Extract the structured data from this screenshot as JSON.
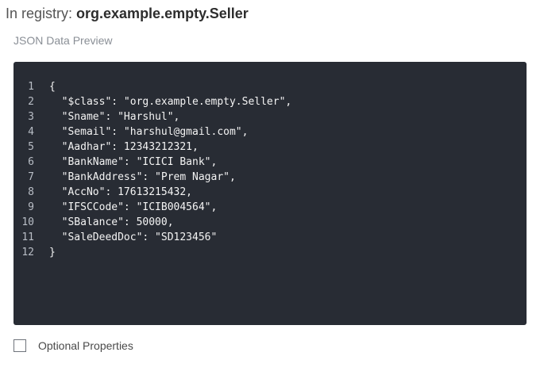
{
  "header": {
    "prefix": "In registry: ",
    "registry": "org.example.empty.Seller"
  },
  "preview": {
    "label": "JSON Data Preview"
  },
  "code": {
    "lines": [
      {
        "number": "1",
        "text": "{"
      },
      {
        "number": "2",
        "text": "  \"$class\": \"org.example.empty.Seller\","
      },
      {
        "number": "3",
        "text": "  \"Sname\": \"Harshul\","
      },
      {
        "number": "4",
        "text": "  \"Semail\": \"harshul@gmail.com\","
      },
      {
        "number": "5",
        "text": "  \"Aadhar\": 12343212321,"
      },
      {
        "number": "6",
        "text": "  \"BankName\": \"ICICI Bank\","
      },
      {
        "number": "7",
        "text": "  \"BankAddress\": \"Prem Nagar\","
      },
      {
        "number": "8",
        "text": "  \"AccNo\": 17613215432,"
      },
      {
        "number": "9",
        "text": "  \"IFSCCode\": \"ICIB004564\","
      },
      {
        "number": "10",
        "text": "  \"SBalance\": 50000,"
      },
      {
        "number": "11",
        "text": "  \"SaleDeedDoc\": \"SD123456\""
      },
      {
        "number": "12",
        "text": "}"
      }
    ]
  },
  "optional": {
    "label": "Optional Properties",
    "checked": false
  }
}
